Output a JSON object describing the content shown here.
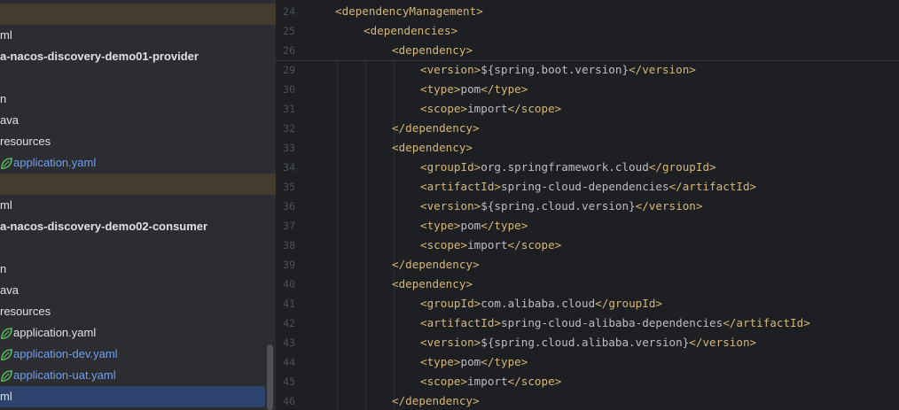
{
  "project_tree": {
    "rows": [
      {
        "label": "",
        "type": "module-header"
      },
      {
        "label": "ml",
        "type": "pom"
      },
      {
        "label": "a-nacos-discovery-demo01-provider",
        "type": "module"
      },
      {
        "label": "",
        "type": "blank"
      },
      {
        "label": "n",
        "type": "folder"
      },
      {
        "label": "ava",
        "type": "folder"
      },
      {
        "label": "resources",
        "type": "folder"
      },
      {
        "label": "application.yaml",
        "type": "yaml-modified",
        "icon": "spring-leaf-icon"
      },
      {
        "label": "",
        "type": "module-header"
      },
      {
        "label": "ml",
        "type": "pom"
      },
      {
        "label": "a-nacos-discovery-demo02-consumer",
        "type": "module"
      },
      {
        "label": "",
        "type": "blank"
      },
      {
        "label": "n",
        "type": "folder"
      },
      {
        "label": "ava",
        "type": "folder"
      },
      {
        "label": "resources",
        "type": "folder"
      },
      {
        "label": "application.yaml",
        "type": "yaml",
        "icon": "spring-leaf-icon"
      },
      {
        "label": "application-dev.yaml",
        "type": "yaml-modified",
        "icon": "spring-leaf-icon"
      },
      {
        "label": "application-uat.yaml",
        "type": "yaml-modified",
        "icon": "spring-leaf-icon"
      },
      {
        "label": "ml",
        "type": "pom-selected"
      }
    ]
  },
  "editor": {
    "sticky_lines": [
      {
        "num": "24",
        "indent": 2,
        "text": "<dependencyManagement>"
      },
      {
        "num": "25",
        "indent": 3,
        "text": "<dependencies>"
      },
      {
        "num": "26",
        "indent": 4,
        "text": "<dependency>"
      }
    ],
    "lines": [
      {
        "num": "29",
        "indent": 5,
        "text": "<version>${spring.boot.version}</version>"
      },
      {
        "num": "30",
        "indent": 5,
        "text": "<type>pom</type>"
      },
      {
        "num": "31",
        "indent": 5,
        "text": "<scope>import</scope>"
      },
      {
        "num": "32",
        "indent": 4,
        "text": "</dependency>"
      },
      {
        "num": "33",
        "indent": 4,
        "text": "<dependency>"
      },
      {
        "num": "34",
        "indent": 5,
        "text": "<groupId>org.springframework.cloud</groupId>"
      },
      {
        "num": "35",
        "indent": 5,
        "text": "<artifactId>spring-cloud-dependencies</artifactId>"
      },
      {
        "num": "36",
        "indent": 5,
        "text": "<version>${spring.cloud.version}</version>"
      },
      {
        "num": "37",
        "indent": 5,
        "text": "<type>pom</type>"
      },
      {
        "num": "38",
        "indent": 5,
        "text": "<scope>import</scope>"
      },
      {
        "num": "39",
        "indent": 4,
        "text": "</dependency>"
      },
      {
        "num": "40",
        "indent": 4,
        "text": "<dependency>"
      },
      {
        "num": "41",
        "indent": 5,
        "text": "<groupId>com.alibaba.cloud</groupId>"
      },
      {
        "num": "42",
        "indent": 5,
        "text": "<artifactId>spring-cloud-alibaba-dependencies</artifactId>"
      },
      {
        "num": "43",
        "indent": 5,
        "text": "<version>${spring.cloud.alibaba.version}</version>"
      },
      {
        "num": "44",
        "indent": 5,
        "text": "<type>pom</type>"
      },
      {
        "num": "45",
        "indent": 5,
        "text": "<scope>import</scope>"
      },
      {
        "num": "46",
        "indent": 4,
        "text": "</dependency>"
      }
    ]
  },
  "colors": {
    "tag": "#d5b778",
    "text": "#bcbec4",
    "line_number": "#4b5059",
    "modified_file": "#6fa0ee",
    "selection": "#2e436e"
  }
}
